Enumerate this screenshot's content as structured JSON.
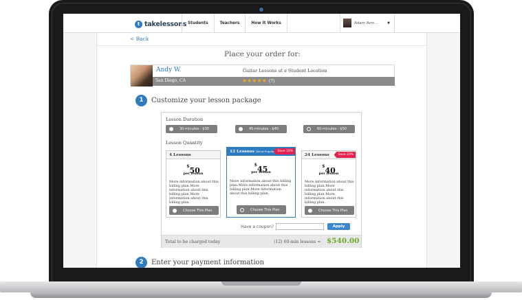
{
  "nav": {
    "brand": "takelessons",
    "links": [
      "Students",
      "Teachers",
      "How It Works"
    ],
    "user_name": "Adam Arm..."
  },
  "page": {
    "back_label": "< Back",
    "title": "Place your order for:"
  },
  "teacher": {
    "name": "Andy W.",
    "lesson_type": "Guitar Lessons at a Student Location",
    "location": "San Diego, CA",
    "rating_stars": 5,
    "review_count": "(7)"
  },
  "step1": {
    "number": "1",
    "title": "Customize your lesson package",
    "duration_label": "Lesson Duration",
    "durations": [
      {
        "label": "30-minutes - $30",
        "selected": false
      },
      {
        "label": "45-minutes - $40",
        "selected": false
      },
      {
        "label": "60-minutes - $50",
        "selected": true
      }
    ],
    "quantity_label": "Lesson Quantity",
    "plans": [
      {
        "title": "4 Lessons",
        "tag": "",
        "save": "",
        "currency": "$",
        "price": "50",
        "per": "per lesson",
        "description": "More information about this billing plan.More information about this billing plan.More information about this billing plan.",
        "button": "Choose This Plan"
      },
      {
        "title": "12 Lessons",
        "tag": "(Most Popular)",
        "save": "Save 10%",
        "currency": "$",
        "price": "45",
        "per": "per lesson",
        "description": "More information about this billing plan.More information about this billing plan.More information about this billing plan.",
        "button": "Choose This Plan"
      },
      {
        "title": "24 Lessons",
        "tag": "",
        "save": "Save 20%",
        "currency": "$",
        "price": "40",
        "per": "per lesson",
        "description": "More information about this billing plan.More information about this billing plan.More information about this billing plan.",
        "button": "Choose This Plan"
      }
    ],
    "coupon_label": "Have a coupon?",
    "coupon_value": "",
    "apply_label": "Apply",
    "total_label": "Total to be charged today",
    "total_desc": "(12) 60-min lessons =",
    "total_amount": "$540.00"
  },
  "step2": {
    "number": "2",
    "title": "Enter your payment information"
  },
  "colors": {
    "accent": "#2e7bbf",
    "total_green": "#6aaa28",
    "save_red": "#e6224c",
    "button_gray": "#7d7d7d"
  }
}
